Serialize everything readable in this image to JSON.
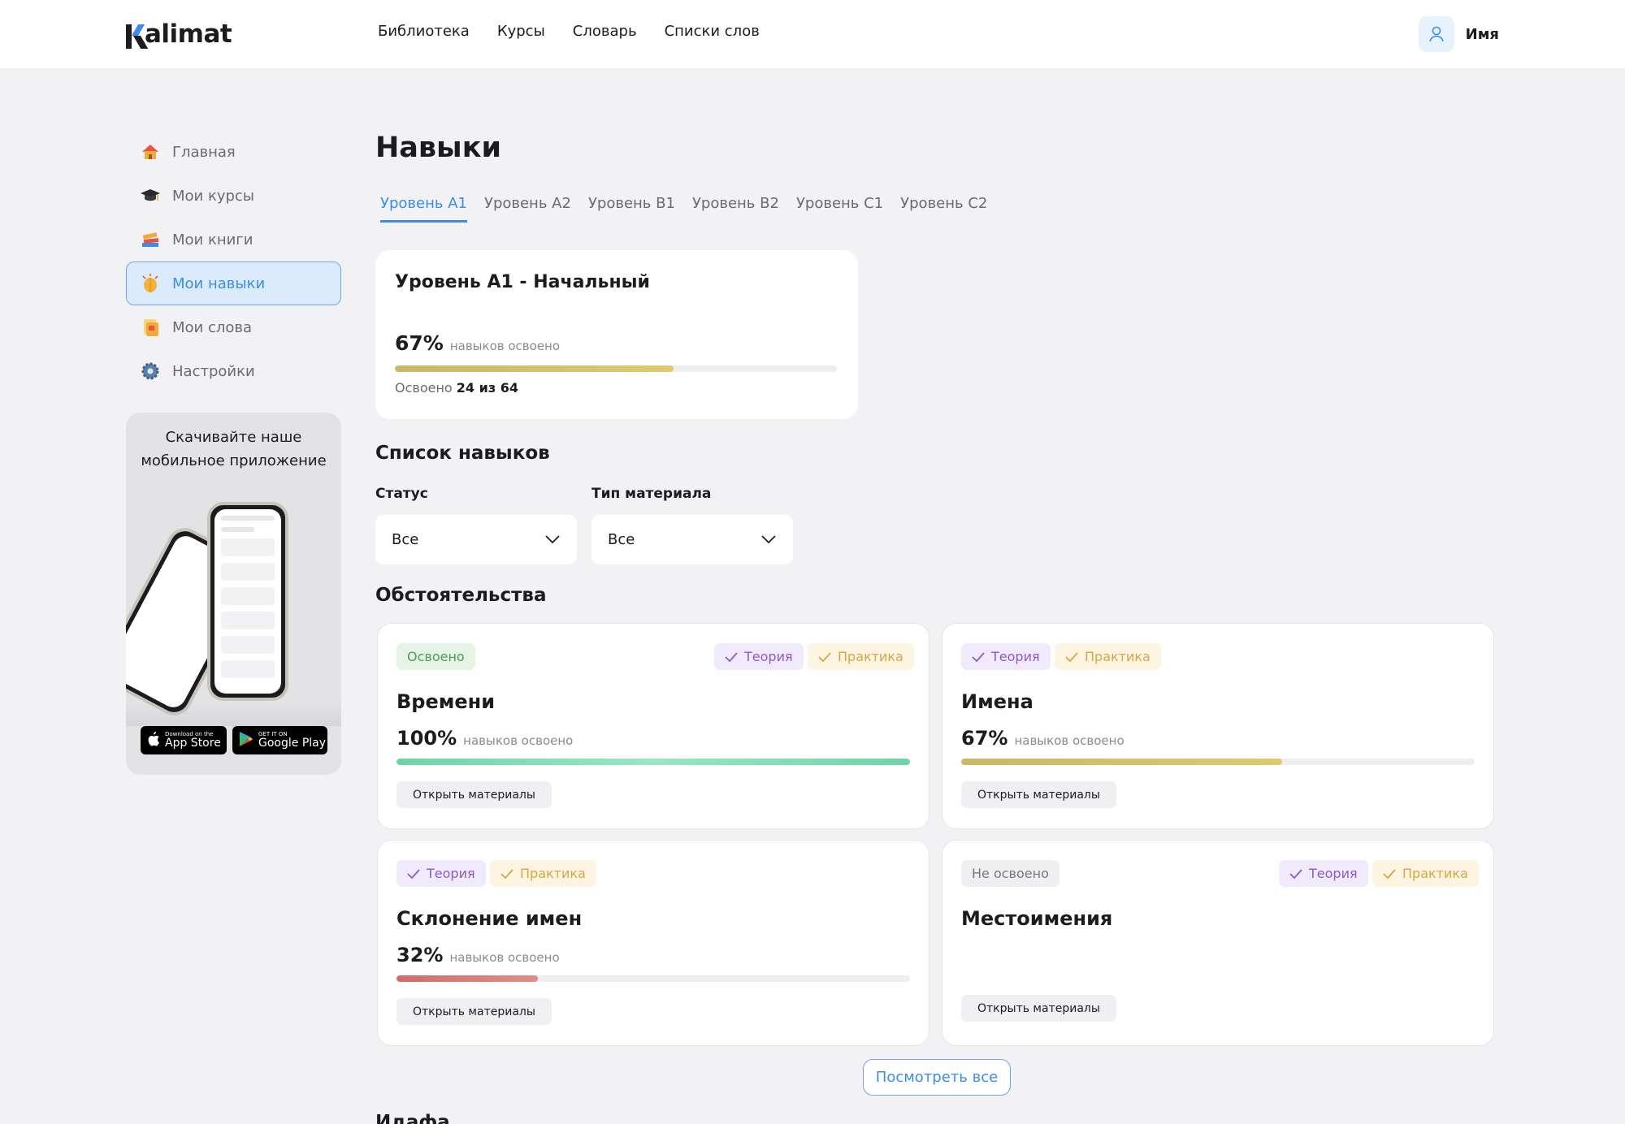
{
  "header": {
    "logo": "kalimat",
    "nav": [
      "Библиотека",
      "Курсы",
      "Словарь",
      "Списки слов"
    ],
    "user_name": "Имя"
  },
  "sidebar": {
    "items": [
      {
        "label": "Главная",
        "icon": "house-icon"
      },
      {
        "label": "Мои курсы",
        "icon": "graduation-cap-icon"
      },
      {
        "label": "Мои книги",
        "icon": "books-icon"
      },
      {
        "label": "Мои навыки",
        "icon": "brain-icon",
        "active": true
      },
      {
        "label": "Мои слова",
        "icon": "cards-icon"
      },
      {
        "label": "Настройки",
        "icon": "gear-icon"
      }
    ],
    "promo": {
      "title": "Скачивайте наше мобильное приложение",
      "app_store_small": "Download on the",
      "app_store_big": "App Store",
      "google_small": "GET IT ON",
      "google_big": "Google Play"
    }
  },
  "main": {
    "title": "Навыки",
    "tabs": [
      "Уровень A1",
      "Уровень A2",
      "Уровень B1",
      "Уровень B2",
      "Уровень C1",
      "Уровень C2"
    ],
    "active_tab": 0,
    "level_card": {
      "title": "Уровень A1 - Начальный",
      "percent": "67%",
      "percent_note": "навыков освоено",
      "progress": 0.63,
      "mastered_prefix": "Освоено",
      "mastered_value": "24 из 64"
    },
    "skills_list_title": "Список навыков",
    "filters": {
      "status_label": "Статус",
      "status_value": "Все",
      "type_label": "Тип материала",
      "type_value": "Все"
    },
    "category_title": "Обстоятельства",
    "next_section_title": "Идафа",
    "theory_label": "Теория",
    "practice_label": "Практика",
    "open_label": "Открыть материалы",
    "skills": [
      {
        "name": "Времени",
        "status": "Освоено",
        "percent": "100%",
        "note": "навыков освоено",
        "progress": 1.0
      },
      {
        "name": "Имена",
        "status": "",
        "percent": "67%",
        "note": "навыков освоено",
        "progress": 0.625
      },
      {
        "name": "Склонение имен",
        "status": "",
        "percent": "32%",
        "note": "навыков освоено",
        "progress": 0.275
      },
      {
        "name": "Местоимения",
        "status": "Не освоено",
        "percent": "",
        "note": "",
        "progress": 0
      }
    ],
    "view_all": "Посмотреть все"
  },
  "colors": {
    "accent": "#3b8de6",
    "gold": "#d6c26a",
    "green": "#6fd3a8",
    "red": "#d46b6b",
    "background": "#f2f2f4"
  }
}
